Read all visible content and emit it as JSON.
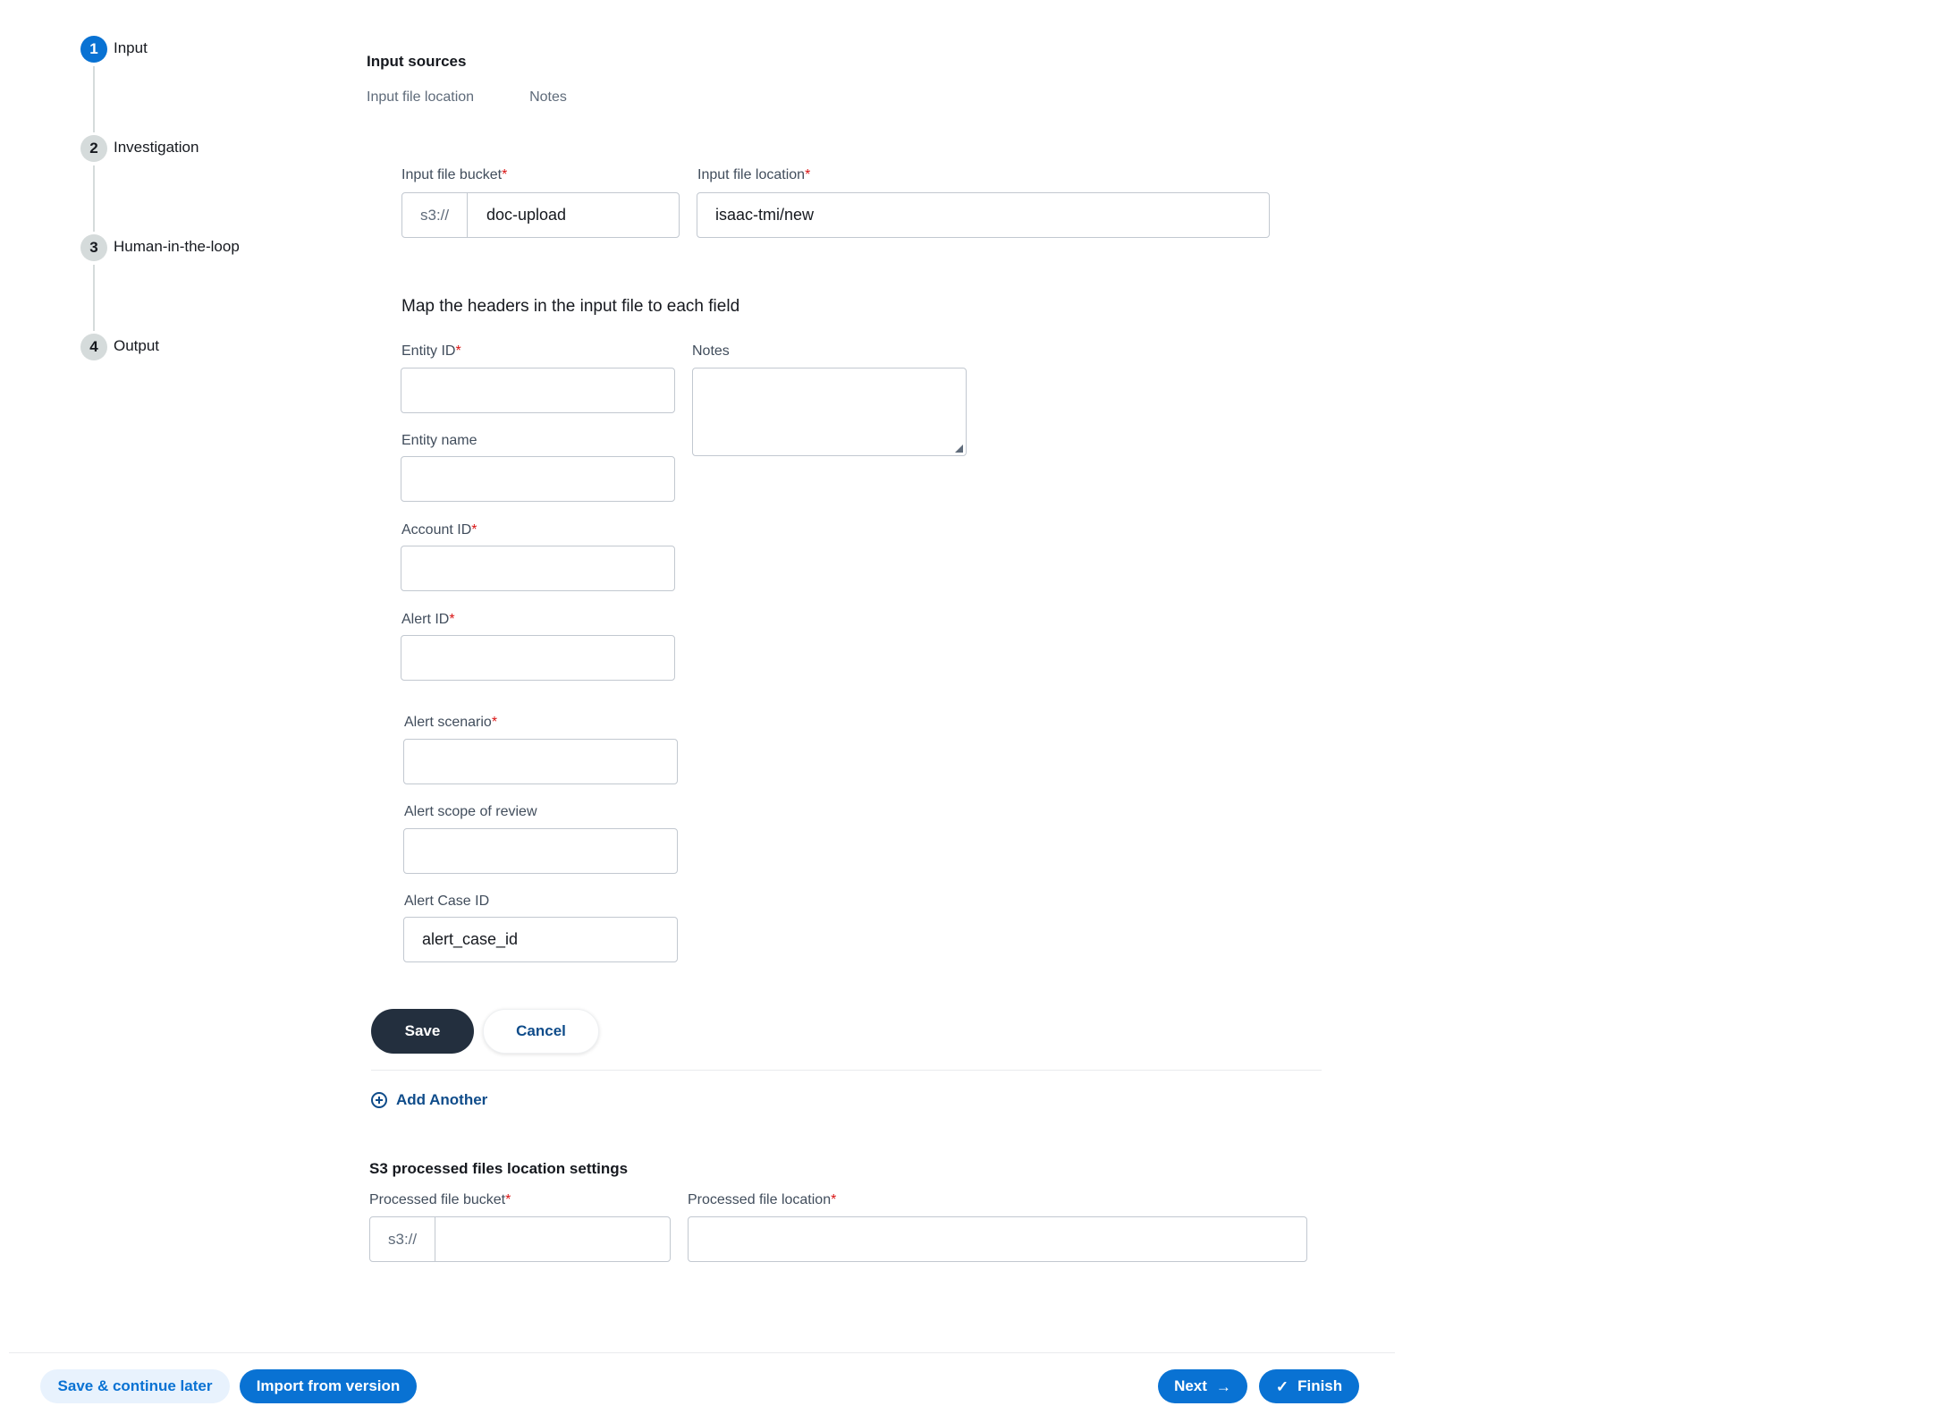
{
  "stepper": {
    "steps": [
      {
        "number": "1",
        "label": "Input"
      },
      {
        "number": "2",
        "label": "Investigation"
      },
      {
        "number": "3",
        "label": "Human-in-the-loop"
      },
      {
        "number": "4",
        "label": "Output"
      }
    ]
  },
  "input_sources": {
    "title": "Input sources",
    "tabs": [
      "Input file location",
      "Notes"
    ],
    "bucket_label": "Input file bucket",
    "bucket_prefix": "s3://",
    "bucket_value": "doc-upload",
    "location_label": "Input file location",
    "location_value": "isaac-tmi/new"
  },
  "mapping": {
    "heading": "Map the headers in the input file to each field",
    "entity_id_label": "Entity ID",
    "entity_id_value": "",
    "notes_label": "Notes",
    "entity_name_label": "Entity name",
    "entity_name_value": "",
    "account_id_label": "Account ID",
    "account_id_value": "",
    "alert_id_label": "Alert ID",
    "alert_id_value": "",
    "alert_scenario_label": "Alert scenario",
    "alert_scenario_value": "",
    "alert_scope_label": "Alert scope of review",
    "alert_scope_value": "",
    "alert_case_label": "Alert Case ID",
    "alert_case_value": "alert_case_id",
    "required_mark": "*"
  },
  "actions": {
    "save_label": "Save",
    "cancel_label": "Cancel",
    "add_another_label": "Add Another"
  },
  "processed": {
    "title": "S3 processed files location settings",
    "bucket_label": "Processed file bucket",
    "bucket_prefix": "s3://",
    "bucket_value": "",
    "location_label": "Processed file location",
    "location_value": ""
  },
  "footer": {
    "save_continue_label": "Save & continue later",
    "import_label": "Import from version",
    "next_label": "Next",
    "finish_label": "Finish"
  },
  "colors": {
    "primary": "#0972d3",
    "dark_button": "#232f3e",
    "required": "#d91515",
    "link": "#0f4c8a"
  }
}
